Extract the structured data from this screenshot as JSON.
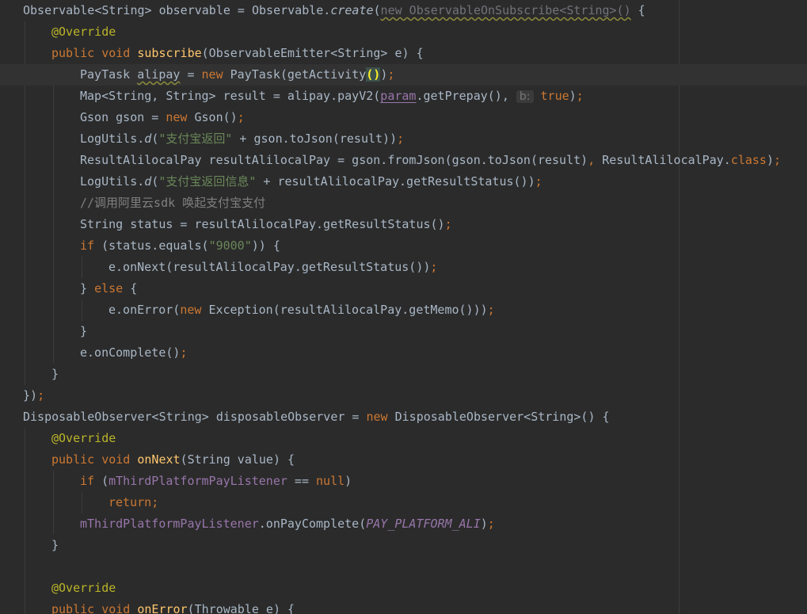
{
  "code_lines": [
    {
      "tokens": [
        {
          "text": "Observable",
          "kind": "plain"
        },
        {
          "text": "<String> observable = Observable.",
          "kind": "plain"
        },
        {
          "text": "create",
          "kind": "static"
        },
        {
          "text": "(",
          "kind": "plain"
        },
        {
          "text": "new ObservableOnSubscribe<String>()",
          "kind": "unused"
        },
        {
          "text": " {",
          "kind": "plain"
        }
      ]
    },
    {
      "tokens": [
        {
          "text": "@Override",
          "kind": "ann"
        }
      ]
    },
    {
      "tokens": [
        {
          "text": "public void ",
          "kind": "kw"
        },
        {
          "text": "subscribe",
          "kind": "method"
        },
        {
          "text": "(ObservableEmitter<String> e) {",
          "kind": "plain"
        }
      ]
    },
    {
      "tokens": [
        {
          "text": "PayTask ",
          "kind": "plain"
        },
        {
          "text": "alipay",
          "kind": "plain"
        },
        {
          "text": " = ",
          "kind": "plain"
        },
        {
          "text": "new ",
          "kind": "kw"
        },
        {
          "text": "PayTask(getActivity",
          "kind": "plain"
        },
        {
          "text": "()",
          "kind": "match"
        },
        {
          "text": ")",
          "kind": "plain"
        },
        {
          "text": ";",
          "kind": "semi"
        }
      ]
    },
    {
      "tokens": [
        {
          "text": "Map<String, String> result = alipay.payV2(",
          "kind": "plain"
        },
        {
          "text": "param",
          "kind": "field"
        },
        {
          "text": ".getPrepay(), ",
          "kind": "plain"
        },
        {
          "text": "b:",
          "kind": "hint"
        },
        {
          "text": " ",
          "kind": "plain"
        },
        {
          "text": "true",
          "kind": "kw"
        },
        {
          "text": ")",
          "kind": "plain"
        },
        {
          "text": ";",
          "kind": "semi"
        }
      ]
    },
    {
      "tokens": [
        {
          "text": "Gson gson = ",
          "kind": "plain"
        },
        {
          "text": "new ",
          "kind": "kw"
        },
        {
          "text": "Gson()",
          "kind": "plain"
        },
        {
          "text": ";",
          "kind": "semi"
        }
      ]
    },
    {
      "tokens": [
        {
          "text": "LogUtils.",
          "kind": "plain"
        },
        {
          "text": "d",
          "kind": "static"
        },
        {
          "text": "(",
          "kind": "plain"
        },
        {
          "text": "\"支付宝返回\"",
          "kind": "str"
        },
        {
          "text": " + gson.toJson(result))",
          "kind": "plain"
        },
        {
          "text": ";",
          "kind": "semi"
        }
      ]
    },
    {
      "tokens": [
        {
          "text": "ResultAlilocalPay resultAlilocalPay = gson.fromJson(gson.toJson(result)",
          "kind": "plain"
        },
        {
          "text": ", ",
          "kind": "semi"
        },
        {
          "text": "ResultAlilocalPay.",
          "kind": "plain"
        },
        {
          "text": "class",
          "kind": "kw"
        },
        {
          "text": ")",
          "kind": "plain"
        },
        {
          "text": ";",
          "kind": "semi"
        }
      ]
    },
    {
      "tokens": [
        {
          "text": "LogUtils.",
          "kind": "plain"
        },
        {
          "text": "d",
          "kind": "static"
        },
        {
          "text": "(",
          "kind": "plain"
        },
        {
          "text": "\"支付宝返回信息\"",
          "kind": "str"
        },
        {
          "text": " + resultAlilocalPay.getResultStatus())",
          "kind": "plain"
        },
        {
          "text": ";",
          "kind": "semi"
        }
      ]
    },
    {
      "tokens": [
        {
          "text": "//调用阿里云sdk 唤起支付宝支付",
          "kind": "comment"
        }
      ]
    },
    {
      "tokens": [
        {
          "text": "String status = resultAlilocalPay.getResultStatus()",
          "kind": "plain"
        },
        {
          "text": ";",
          "kind": "semi"
        }
      ]
    },
    {
      "tokens": [
        {
          "text": "if ",
          "kind": "kw"
        },
        {
          "text": "(status.equals(",
          "kind": "plain"
        },
        {
          "text": "\"9000\"",
          "kind": "str"
        },
        {
          "text": ")) {",
          "kind": "plain"
        }
      ]
    },
    {
      "tokens": [
        {
          "text": "e.onNext(resultAlilocalPay.getResultStatus())",
          "kind": "plain"
        },
        {
          "text": ";",
          "kind": "semi"
        }
      ]
    },
    {
      "tokens": [
        {
          "text": "} ",
          "kind": "plain"
        },
        {
          "text": "else ",
          "kind": "kw"
        },
        {
          "text": "{",
          "kind": "plain"
        }
      ]
    },
    {
      "tokens": [
        {
          "text": "e.onError(",
          "kind": "plain"
        },
        {
          "text": "new ",
          "kind": "kw"
        },
        {
          "text": "Exception(resultAlilocalPay.getMemo()))",
          "kind": "plain"
        },
        {
          "text": ";",
          "kind": "semi"
        }
      ]
    },
    {
      "tokens": [
        {
          "text": "}",
          "kind": "plain"
        }
      ]
    },
    {
      "tokens": [
        {
          "text": "e.onComplete()",
          "kind": "plain"
        },
        {
          "text": ";",
          "kind": "semi"
        }
      ]
    },
    {
      "tokens": [
        {
          "text": "}",
          "kind": "plain"
        }
      ]
    },
    {
      "tokens": [
        {
          "text": "})",
          "kind": "plain"
        },
        {
          "text": ";",
          "kind": "semi"
        }
      ]
    },
    {
      "tokens": [
        {
          "text": "DisposableObserver<String> disposableObserver = ",
          "kind": "plain"
        },
        {
          "text": "new ",
          "kind": "kw"
        },
        {
          "text": "DisposableObserver<String>() {",
          "kind": "plain"
        }
      ]
    },
    {
      "tokens": [
        {
          "text": "@Override",
          "kind": "ann"
        }
      ]
    },
    {
      "tokens": [
        {
          "text": "public void ",
          "kind": "kw"
        },
        {
          "text": "onNext",
          "kind": "method"
        },
        {
          "text": "(String value) {",
          "kind": "plain"
        }
      ]
    },
    {
      "tokens": [
        {
          "text": "if ",
          "kind": "kw"
        },
        {
          "text": "(",
          "kind": "plain"
        },
        {
          "text": "mThirdPlatformPayListener",
          "kind": "field"
        },
        {
          "text": " == ",
          "kind": "plain"
        },
        {
          "text": "null",
          "kind": "kw"
        },
        {
          "text": ")",
          "kind": "plain"
        }
      ]
    },
    {
      "tokens": [
        {
          "text": "return",
          "kind": "kw"
        },
        {
          "text": ";",
          "kind": "semi"
        }
      ]
    },
    {
      "tokens": [
        {
          "text": "mThirdPlatformPayListener",
          "kind": "field"
        },
        {
          "text": ".onPayComplete(",
          "kind": "plain"
        },
        {
          "text": "PAY_PLATFORM_ALI",
          "kind": "const"
        },
        {
          "text": ")",
          "kind": "plain"
        },
        {
          "text": ";",
          "kind": "semi"
        }
      ]
    },
    {
      "tokens": [
        {
          "text": "}",
          "kind": "plain"
        }
      ]
    },
    {
      "tokens": []
    },
    {
      "tokens": [
        {
          "text": "@Override",
          "kind": "ann"
        }
      ]
    },
    {
      "tokens": [
        {
          "text": "public void ",
          "kind": "kw"
        },
        {
          "text": "onError",
          "kind": "method"
        },
        {
          "text": "(Throwable e) {",
          "kind": "plain"
        }
      ]
    }
  ]
}
